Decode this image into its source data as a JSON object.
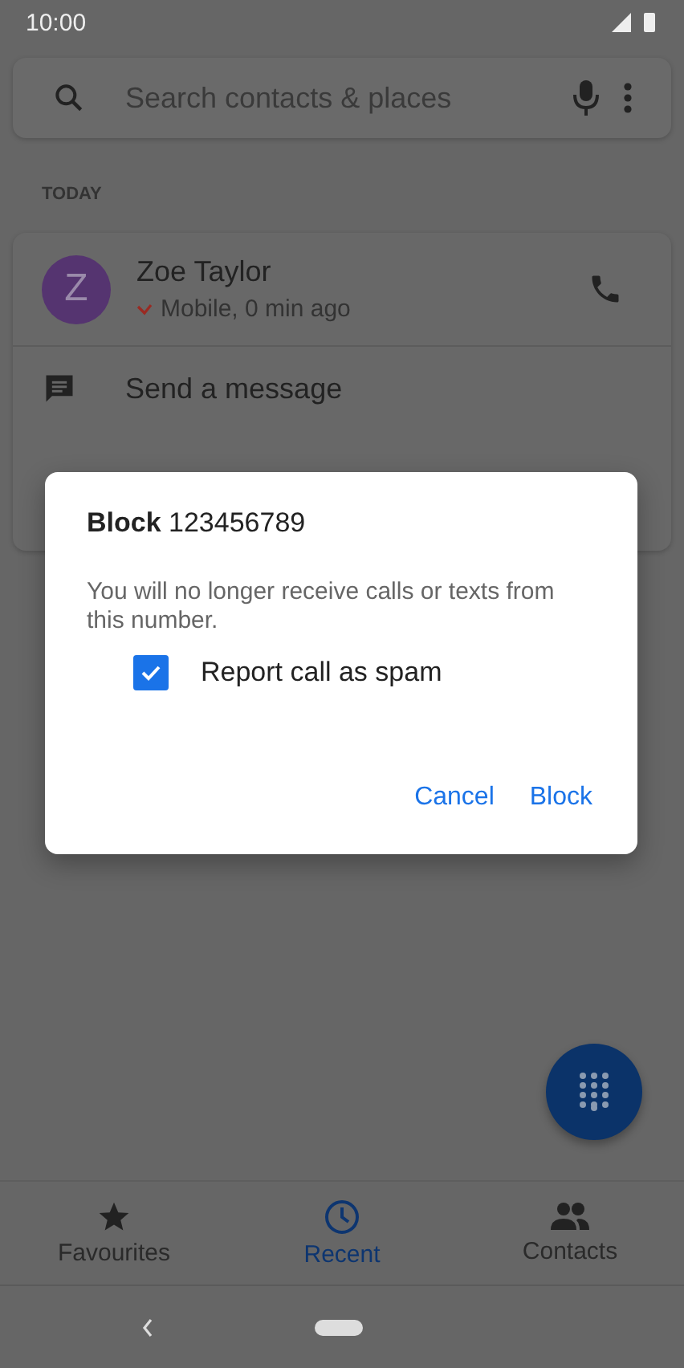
{
  "status_bar": {
    "time": "10:00"
  },
  "search": {
    "placeholder": "Search contacts & places"
  },
  "section_header": "TODAY",
  "call_log": [
    {
      "initial": "Z",
      "name": "Zoe Taylor",
      "missed": true,
      "detail": "Mobile, 0 min ago"
    }
  ],
  "actions": [
    {
      "label": "Send a message"
    }
  ],
  "dialog": {
    "title": "**Block** 123456789",
    "message": "You will no longer receive calls or texts from this number.",
    "checkbox": {
      "label": "Report call as spam",
      "checked": true
    },
    "buttons": [
      "Cancel",
      "Block"
    ]
  },
  "tabs": [
    {
      "label": "Favourites",
      "selected": false
    },
    {
      "label": "Recent",
      "selected": true
    },
    {
      "label": "Contacts",
      "selected": false
    }
  ]
}
